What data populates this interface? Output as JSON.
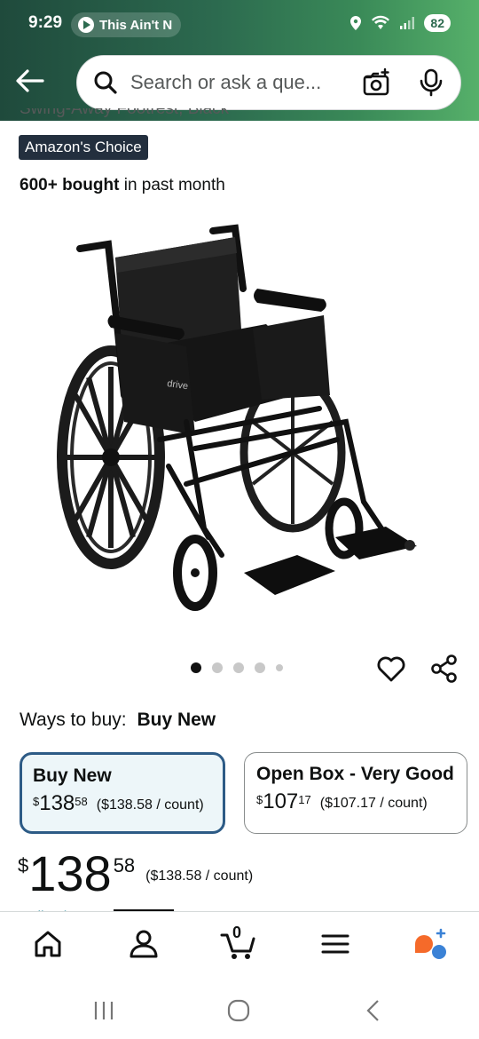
{
  "status": {
    "time": "9:29",
    "media_label": "This Ain't N",
    "battery": "82"
  },
  "header": {
    "search_placeholder": "Search or ask a que..."
  },
  "product": {
    "title_cut": "Swing-Away Footrest, Black",
    "badge": "Amazon's Choice",
    "bought_bold": "600+ bought",
    "bought_rest": "in past month",
    "image_dots": 5,
    "active_dot": 0
  },
  "buy": {
    "ways_label": "Ways to buy:",
    "ways_selected": "Buy New",
    "options": [
      {
        "title": "Buy New",
        "symbol": "$",
        "whole": "138",
        "fraction": "58",
        "unit": "($138.58 / count)",
        "selected": true
      },
      {
        "title": "Open Box - Very Good",
        "symbol": "$",
        "whole": "107",
        "fraction": "17",
        "unit": "($107.17 / count)",
        "selected": false
      }
    ],
    "price": {
      "symbol": "$",
      "whole": "138",
      "fraction": "58",
      "unit": "($138.58 / count)"
    },
    "cut_link": "Delivering to"
  },
  "nav": {
    "cart_count": "0",
    "items": [
      "home",
      "account",
      "cart",
      "menu",
      "rufus"
    ]
  },
  "colors": {
    "header_start": "#1f4a3c",
    "header_end": "#56b06a",
    "badge_bg": "#232f3e",
    "selected_border": "#2d5b86",
    "selected_bg": "#edf6f9"
  }
}
